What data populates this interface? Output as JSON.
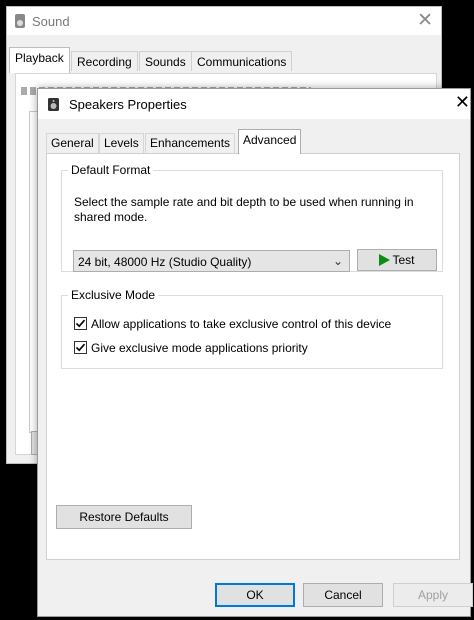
{
  "sound_window": {
    "title": "Sound",
    "tabs": [
      "Playback",
      "Recording",
      "Sounds",
      "Communications"
    ]
  },
  "dialog": {
    "title": "Speakers Properties",
    "tabs": [
      "General",
      "Levels",
      "Enhancements",
      "Advanced"
    ],
    "active_tab": "Advanced",
    "default_format": {
      "legend": "Default Format",
      "description": "Select the sample rate and bit depth to be used when running in shared mode.",
      "selected_format": "24 bit, 48000 Hz (Studio Quality)",
      "test_label": "Test"
    },
    "exclusive_mode": {
      "legend": "Exclusive Mode",
      "options": [
        {
          "label": "Allow applications to take exclusive control of this device",
          "checked": true
        },
        {
          "label": "Give exclusive mode applications priority",
          "checked": true
        }
      ]
    },
    "restore_label": "Restore Defaults",
    "buttons": {
      "ok": "OK",
      "cancel": "Cancel",
      "apply": "Apply"
    }
  },
  "icons": [
    "speaker-icon",
    "close-icon",
    "play-icon",
    "chevron-down-icon",
    "checkmark-icon"
  ],
  "colors": {
    "test_play": "#0e8a16",
    "ok_border": "#0078d7"
  }
}
